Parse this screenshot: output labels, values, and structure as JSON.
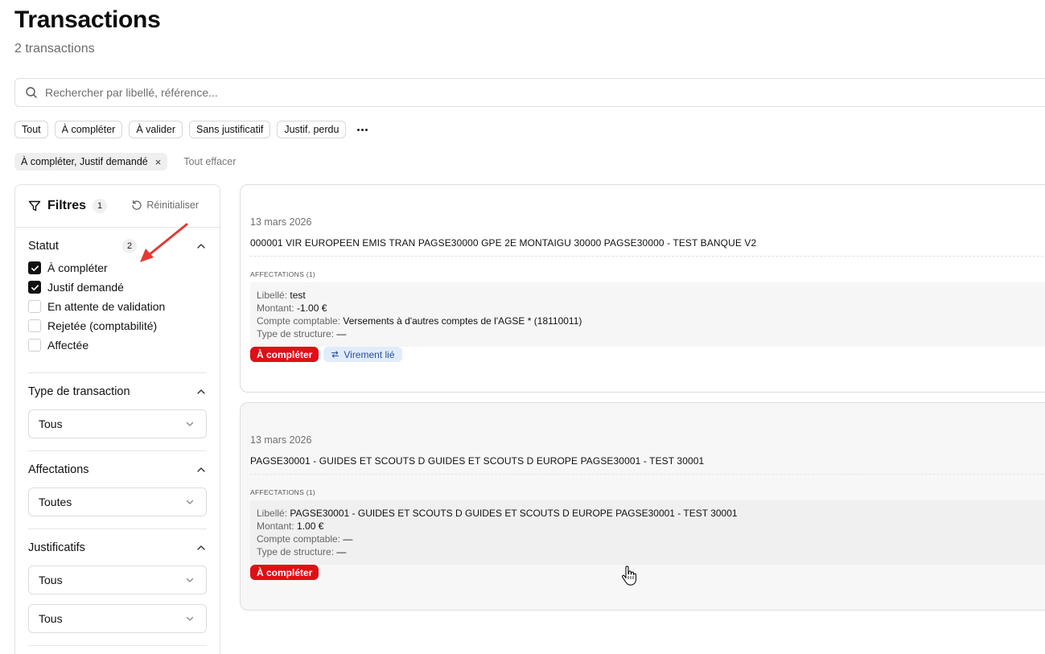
{
  "header": {
    "title": "Transactions",
    "subtitle": "2 transactions"
  },
  "search": {
    "placeholder": "Rechercher par libellé, référence..."
  },
  "quick_filters": [
    "Tout",
    "À compléter",
    "À valider",
    "Sans justificatif",
    "Justif. perdu"
  ],
  "active_filter": {
    "label": "À compléter, Justif demandé",
    "remove": "×",
    "clear_all": "Tout effacer"
  },
  "sidebar": {
    "title": "Filtres",
    "count": "1",
    "reset": "Réinitialiser",
    "statut": {
      "title": "Statut",
      "count": "2",
      "options": [
        {
          "label": "À compléter",
          "checked": true
        },
        {
          "label": "Justif demandé",
          "checked": true
        },
        {
          "label": "En attente de validation",
          "checked": false
        },
        {
          "label": "Rejetée (comptabilité)",
          "checked": false
        },
        {
          "label": "Affectée",
          "checked": false
        }
      ]
    },
    "type_transaction": {
      "title": "Type de transaction",
      "value": "Tous"
    },
    "affectations": {
      "title": "Affectations",
      "value": "Toutes"
    },
    "justificatifs": {
      "title": "Justificatifs",
      "value1": "Tous",
      "value2": "Tous"
    }
  },
  "transactions": [
    {
      "date": "13 mars 2026",
      "reference": "000001 VIR EUROPEEN EMIS TRAN PAGSE30000 GPE 2E MONTAIGU 30000 PAGSE30000 - TEST BANQUE V2",
      "affectations_label": "AFFECTATIONS (1)",
      "libelle_key": "Libellé:",
      "libelle": "test",
      "montant_key": "Montant:",
      "montant": "-1.00 €",
      "compte_key": "Compte comptable:",
      "compte": "Versements à d'autres comptes de l'AGSE * (18110011)",
      "type_key": "Type de structure:",
      "type": "—",
      "status_badge": "À compléter",
      "link_badge": "Virement lié"
    },
    {
      "date": "13 mars 2026",
      "reference": "PAGSE30001 - GUIDES ET SCOUTS D GUIDES ET SCOUTS D EUROPE PAGSE30001 - TEST 30001",
      "affectations_label": "AFFECTATIONS (1)",
      "libelle_key": "Libellé:",
      "libelle": "PAGSE30001 - GUIDES ET SCOUTS D GUIDES ET SCOUTS D EUROPE PAGSE30001 - TEST 30001",
      "montant_key": "Montant:",
      "montant": "1.00 €",
      "compte_key": "Compte comptable:",
      "compte": "—",
      "type_key": "Type de structure:",
      "type": "—",
      "status_badge": "À compléter"
    }
  ],
  "colors": {
    "status_red": "#e00f16",
    "link_blue_bg": "#e1ecfb",
    "link_blue_text": "#2a4f9e",
    "annotation_arrow": "#e53935"
  }
}
